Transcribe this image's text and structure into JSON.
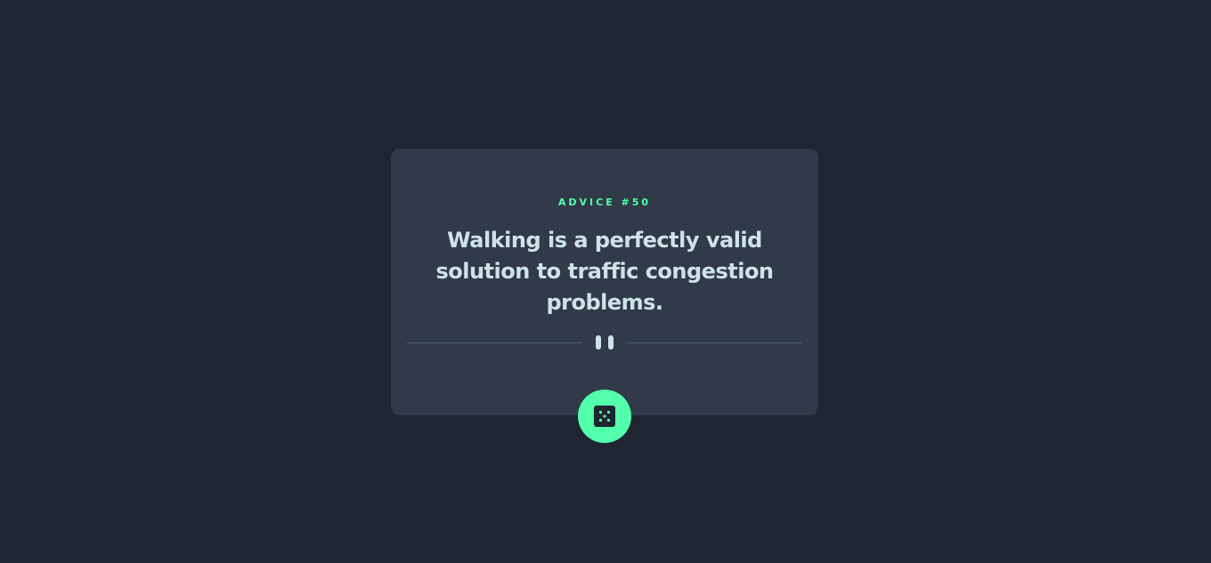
{
  "card": {
    "advice_label": "ADVICE #50",
    "quote": "Walking is a perfectly valid solution to traffic congestion problems."
  },
  "icons": {
    "divider": "pause-icon",
    "button": "dice-icon"
  },
  "colors": {
    "background": "#1f2632",
    "card": "#313a48",
    "accent": "#53ffaa",
    "text": "#cee3e9",
    "divider": "#4f5d74"
  }
}
